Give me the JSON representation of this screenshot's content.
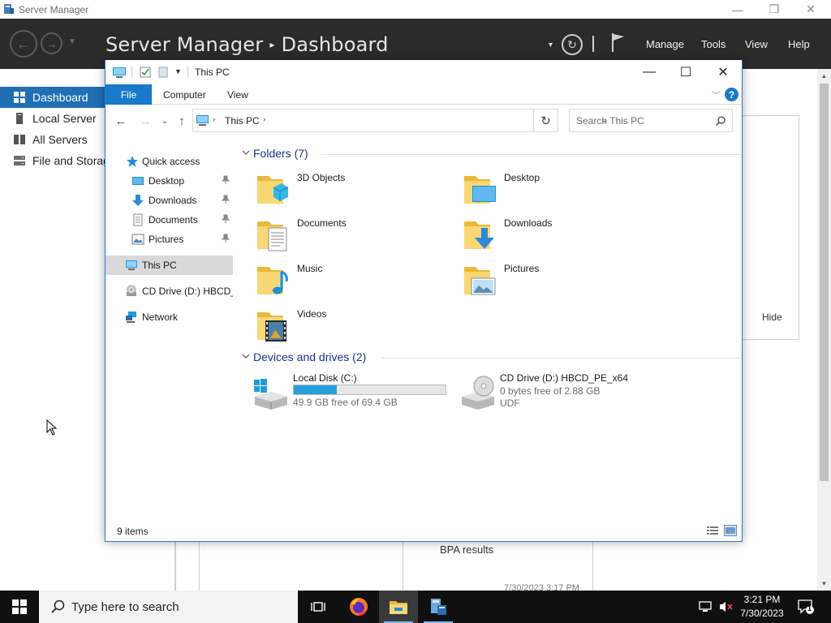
{
  "server_manager": {
    "window_title": "Server Manager",
    "breadcrumb_app": "Server Manager",
    "breadcrumb_page": "Dashboard",
    "menu": [
      "Manage",
      "Tools",
      "View",
      "Help"
    ],
    "sidebar": [
      {
        "label": "Dashboard",
        "icon": "dashboard-icon",
        "active": true
      },
      {
        "label": "Local Server",
        "icon": "server-icon",
        "active": false
      },
      {
        "label": "All Servers",
        "icon": "servers-icon",
        "active": false
      },
      {
        "label": "File and Storag",
        "icon": "storage-icon",
        "active": false
      }
    ],
    "hide_label": "Hide",
    "bpa_label": "BPA results",
    "partial_timestamp": "7/30/2023 3:17 PM",
    "accent_color": "#1f6fb5"
  },
  "explorer": {
    "title": "This PC",
    "ribbon_tabs": [
      "File",
      "Computer",
      "View"
    ],
    "address": "This PC",
    "search_placeholder": "Search This PC",
    "nav_pane": {
      "quick_access": "Quick access",
      "pinned": [
        {
          "label": "Desktop",
          "icon": "desktop-icon"
        },
        {
          "label": "Downloads",
          "icon": "downloads-icon"
        },
        {
          "label": "Documents",
          "icon": "documents-icon"
        },
        {
          "label": "Pictures",
          "icon": "pictures-icon"
        }
      ],
      "this_pc": "This PC",
      "cd_drive": "CD Drive (D:) HBCD_PE_x64",
      "network": "Network"
    },
    "folders_header": "Folders (7)",
    "folders": [
      {
        "name": "3D Objects",
        "icon": "3d-objects-folder-icon"
      },
      {
        "name": "Desktop",
        "icon": "desktop-folder-icon"
      },
      {
        "name": "Documents",
        "icon": "documents-folder-icon"
      },
      {
        "name": "Downloads",
        "icon": "downloads-folder-icon"
      },
      {
        "name": "Music",
        "icon": "music-folder-icon"
      },
      {
        "name": "Pictures",
        "icon": "pictures-folder-icon"
      },
      {
        "name": "Videos",
        "icon": "videos-folder-icon"
      }
    ],
    "devices_header": "Devices and drives (2)",
    "drives": [
      {
        "name": "Local Disk (C:)",
        "free_text": "49.9 GB free of 69.4 GB",
        "used_fraction": 0.281,
        "fs": ""
      },
      {
        "name": "CD Drive (D:) HBCD_PE_x64",
        "free_text": "0 bytes free of 2.88 GB",
        "used_fraction": null,
        "fs": "UDF"
      }
    ],
    "status": "9 items"
  },
  "taskbar": {
    "search_placeholder": "Type here to search",
    "time": "3:21 PM",
    "date": "7/30/2023",
    "notification_count": "1",
    "apps": [
      "task-view-icon",
      "firefox-icon",
      "file-explorer-icon",
      "server-manager-icon"
    ]
  }
}
